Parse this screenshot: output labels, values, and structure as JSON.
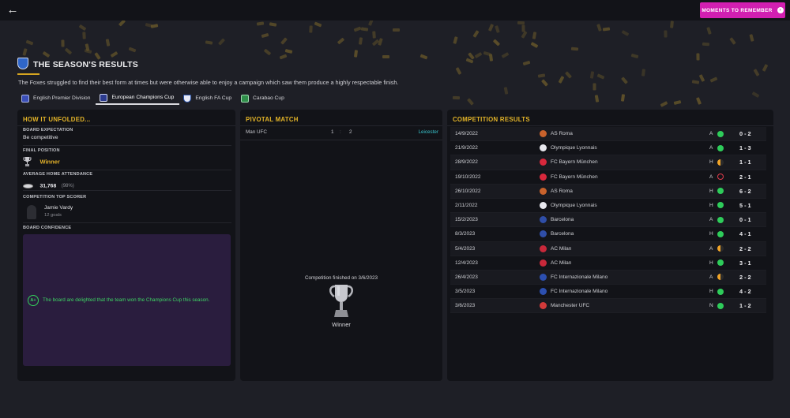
{
  "topbar": {
    "back_label": "←",
    "moments_label": "MOMENTS TO REMEMBER",
    "moments_icon": "›"
  },
  "header": {
    "title": "THE SEASON'S RESULTS",
    "summary": "The Foxes struggled to find their best form at times but were otherwise able to enjoy a campaign which saw them produce a highly respectable finish."
  },
  "tabs": [
    {
      "label": "English Premier Division",
      "logo": "epl-logo-icon",
      "active": false
    },
    {
      "label": "European Champions Cup",
      "logo": "champions-cup-logo-icon",
      "active": true
    },
    {
      "label": "English FA Cup",
      "logo": "fa-cup-logo-icon",
      "active": false
    },
    {
      "label": "Carabao Cup",
      "logo": "carabao-cup-logo-icon",
      "active": false
    }
  ],
  "unfolded": {
    "title": "HOW IT UNFOLDED...",
    "expectation_label": "BOARD EXPECTATION",
    "expectation_value": "Be competitive",
    "position_label": "FINAL POSITION",
    "position_value": "Winner",
    "attendance_label": "AVERAGE HOME ATTENDANCE",
    "attendance_value": "31,768",
    "attendance_pct": "(98%)",
    "scorer_label": "COMPETITION TOP SCORER",
    "scorer_name": "Jamie Vardy",
    "scorer_goals": "12 goals",
    "confidence_label": "BOARD CONFIDENCE",
    "confidence_grade": "A+",
    "confidence_text": "The board are delighted that the team won the Champions Cup this season."
  },
  "pivotal": {
    "title": "PIVOTAL MATCH",
    "home": "Man UFC",
    "home_score": "1",
    "separator": ":",
    "away_score": "2",
    "away": "Leicester",
    "finished_text": "Competition finished on 3/6/2023",
    "result": "Winner"
  },
  "competition": {
    "title": "COMPETITION RESULTS",
    "results": [
      {
        "date": "14/9/2022",
        "team": "AS Roma",
        "venue": "A",
        "outcome": "W",
        "score": "0 - 2",
        "color": "#c8622c"
      },
      {
        "date": "21/9/2022",
        "team": "Olympique Lyonnais",
        "venue": "A",
        "outcome": "W",
        "score": "1 - 3",
        "color": "#e8e8ee"
      },
      {
        "date": "28/9/2022",
        "team": "FC Bayern München",
        "venue": "H",
        "outcome": "D",
        "score": "1 - 1",
        "color": "#d8283c"
      },
      {
        "date": "19/10/2022",
        "team": "FC Bayern München",
        "venue": "A",
        "outcome": "L",
        "score": "2 - 1",
        "color": "#d8283c"
      },
      {
        "date": "26/10/2022",
        "team": "AS Roma",
        "venue": "H",
        "outcome": "W",
        "score": "6 - 2",
        "color": "#c8622c"
      },
      {
        "date": "2/11/2022",
        "team": "Olympique Lyonnais",
        "venue": "H",
        "outcome": "W",
        "score": "5 - 1",
        "color": "#e8e8ee"
      },
      {
        "date": "15/2/2023",
        "team": "Barcelona",
        "venue": "A",
        "outcome": "W",
        "score": "0 - 1",
        "color": "#2f4ea8"
      },
      {
        "date": "8/3/2023",
        "team": "Barcelona",
        "venue": "H",
        "outcome": "W",
        "score": "4 - 1",
        "color": "#2f4ea8"
      },
      {
        "date": "5/4/2023",
        "team": "AC Milan",
        "venue": "A",
        "outcome": "D",
        "score": "2 - 2",
        "color": "#c8283a"
      },
      {
        "date": "12/4/2023",
        "team": "AC Milan",
        "venue": "H",
        "outcome": "W",
        "score": "3 - 1",
        "color": "#c8283a"
      },
      {
        "date": "26/4/2023",
        "team": "FC Internazionale Milano",
        "venue": "A",
        "outcome": "D",
        "score": "2 - 2",
        "color": "#2c4fb0"
      },
      {
        "date": "3/5/2023",
        "team": "FC Internazionale Milano",
        "venue": "H",
        "outcome": "W",
        "score": "4 - 2",
        "color": "#2c4fb0"
      },
      {
        "date": "3/6/2023",
        "team": "Manchester UFC",
        "venue": "N",
        "outcome": "W",
        "score": "1 - 2",
        "color": "#d23a3a"
      }
    ]
  }
}
